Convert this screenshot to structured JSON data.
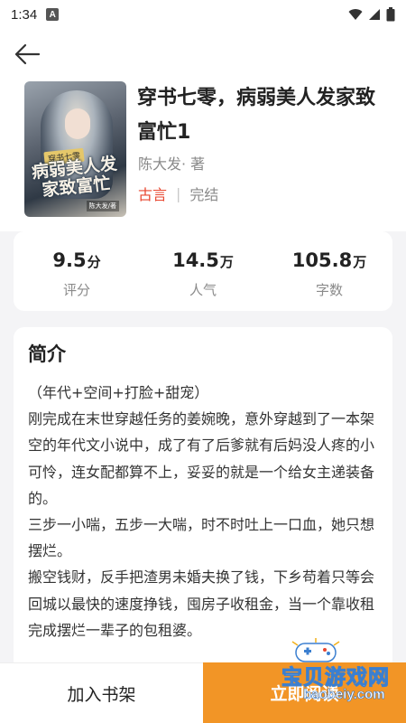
{
  "status_bar": {
    "time": "1:34",
    "notification_badge": "A"
  },
  "book": {
    "title": "穿书七零，病弱美人发家致富忙1",
    "author": "陈大发· 著",
    "genre": "古言",
    "separator": "|",
    "status": "完结",
    "cover": {
      "tag": "穿书七零",
      "title": "病弱美人发家致富忙",
      "author": "陈大发/著"
    }
  },
  "stats": [
    {
      "value": "9.5",
      "unit": "分",
      "label": "评分"
    },
    {
      "value": "14.5",
      "unit": "万",
      "label": "人气"
    },
    {
      "value": "105.8",
      "unit": "万",
      "label": "字数"
    }
  ],
  "intro": {
    "heading": "简介",
    "paragraphs": [
      "（年代+空间+打脸+甜宠）",
      "刚完成在末世穿越任务的姜婉晚，意外穿越到了一本架空的年代文小说中，成了有了后爹就有后妈没人疼的小可怜，连女配都算不上，妥妥的就是一个给女主递装备的。",
      "三步一小喘，五步一大喘，时不时吐上一口血，她只想摆烂。",
      "搬空钱财，反手把渣男未婚夫换了钱，下乡苟着只等会回城以最快的速度挣钱，囤房子收租金，当一个靠收租完成摆烂一辈子的包租婆。"
    ]
  },
  "bottom_bar": {
    "add_shelf_label": "加入书架",
    "read_label": "立即阅读"
  },
  "watermark": {
    "text": "宝贝游戏网",
    "url": "baobeiy.com"
  },
  "colors": {
    "accent_orange": "#f29526",
    "genre_red": "#e8462f",
    "background": "#f4f4f6"
  }
}
